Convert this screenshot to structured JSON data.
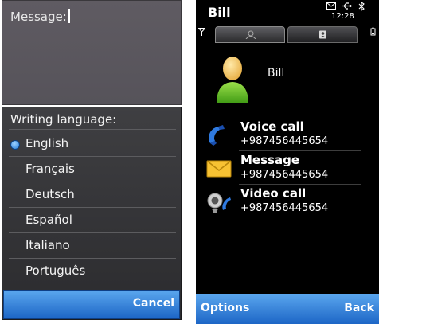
{
  "left": {
    "message_label": "Message:",
    "language_popup": {
      "title": "Writing language:",
      "options": [
        "English",
        "Français",
        "Deutsch",
        "Español",
        "Italiano",
        "Português"
      ],
      "selected": "English"
    },
    "softkeys": {
      "right": "Cancel"
    }
  },
  "right": {
    "title": "Bill",
    "status": {
      "time": "12:28"
    },
    "contact": {
      "name": "Bill"
    },
    "actions": [
      {
        "label": "Voice call",
        "number": "+987456445654",
        "icon": "phone-handset-icon"
      },
      {
        "label": "Message",
        "number": "+987456445654",
        "icon": "envelope-icon"
      },
      {
        "label": "Video call",
        "number": "+987456445654",
        "icon": "video-camera-icon"
      }
    ],
    "softkeys": {
      "left": "Options",
      "right": "Back"
    }
  },
  "colors": {
    "accent": "#1e72d6",
    "selection": "#1e78d8"
  }
}
